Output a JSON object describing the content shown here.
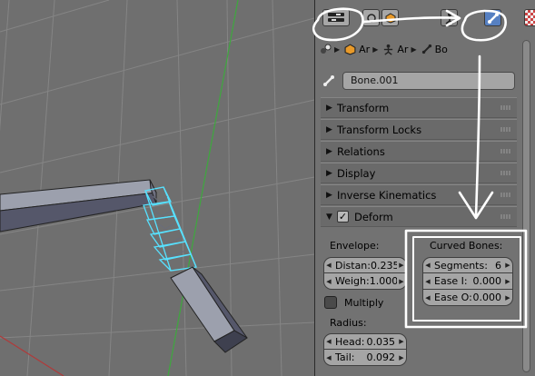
{
  "viewport": {
    "grid_color": "#8c8c8c",
    "x_axis_color": "#b03a3a",
    "y_axis_color": "#3ea83e",
    "bone_color": "#9b9eab",
    "selected_outline_color": "#57e1ff"
  },
  "context_tabs": {
    "items": [
      {
        "icon": "render-layers-icon"
      },
      {
        "icon": "scene-icon"
      },
      {
        "icon": "object-icon"
      },
      {
        "icon": "armature-data-icon"
      },
      {
        "icon": "bone-icon",
        "active": true
      },
      {
        "icon": "texture-icon"
      }
    ]
  },
  "breadcrumb": {
    "items": [
      {
        "icon": "scene-icon",
        "label": ""
      },
      {
        "icon": "object-icon",
        "label": "Ar"
      },
      {
        "icon": "armature-data-icon",
        "label": "Ar"
      },
      {
        "icon": "bone-icon",
        "label": "Bo"
      }
    ]
  },
  "bone_name": {
    "value": "Bone.001"
  },
  "sections": {
    "transform": "Transform",
    "transform_locks": "Transform Locks",
    "relations": "Relations",
    "display": "Display",
    "inverse_kinematics": "Inverse Kinematics",
    "deform": "Deform"
  },
  "deform": {
    "envelope_label": "Envelope:",
    "distance_label": "Distan:",
    "distance_value": "0.235",
    "weight_label": "Weigh:",
    "weight_value": "1.000",
    "multiply_label": "Multiply",
    "radius_label": "Radius:",
    "head_label": "Head:",
    "head_value": "0.035",
    "tail_label": "Tail:",
    "tail_value": "0.092",
    "curved_bones_label": "Curved Bones:",
    "segments_label": "Segments:",
    "segments_value": "6",
    "ease_in_label": "Ease I:",
    "ease_in_value": "0.000",
    "ease_out_label": "Ease O:",
    "ease_out_value": "0.000"
  },
  "colors": {
    "active_tab": "#5680c2",
    "panel_bg": "#727272",
    "annotation": "#ffffff"
  }
}
